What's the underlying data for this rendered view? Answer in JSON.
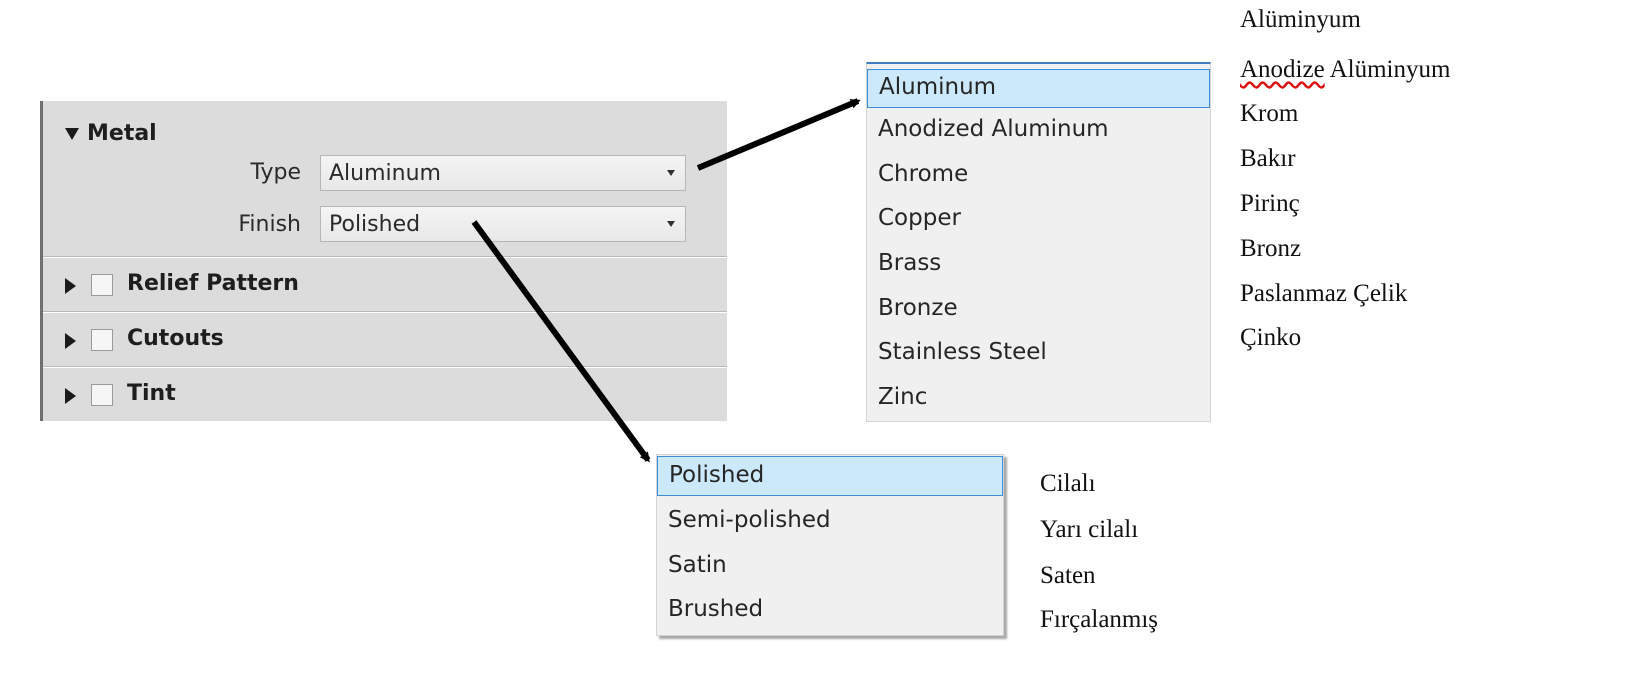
{
  "panel": {
    "metal": {
      "title": "Metal",
      "type_label": "Type",
      "type_value": "Aluminum",
      "finish_label": "Finish",
      "finish_value": "Polished"
    },
    "sections": [
      {
        "title": "Relief Pattern"
      },
      {
        "title": "Cutouts"
      },
      {
        "title": "Tint"
      }
    ]
  },
  "type_options": [
    "Aluminum",
    "Anodized Aluminum",
    "Chrome",
    "Copper",
    "Brass",
    "Bronze",
    "Stainless Steel",
    "Zinc"
  ],
  "finish_options": [
    "Polished",
    "Semi-polished",
    "Satin",
    "Brushed"
  ],
  "type_translations": [
    "Alüminyum",
    "Anodize",
    "Alüminyum",
    "Krom",
    "Bakır",
    "Pirinç",
    "Bronz",
    "Paslanmaz Çelik",
    "Çinko"
  ],
  "finish_translations": [
    "Cilalı",
    "Yarı cilalı",
    "Saten",
    "Fırçalanmış"
  ],
  "colors": {
    "panel_bg": "#dcdcdc",
    "selected_bg": "#cce8fb",
    "selected_border": "#3c8fd8",
    "list_bg": "#f0f0f0"
  }
}
